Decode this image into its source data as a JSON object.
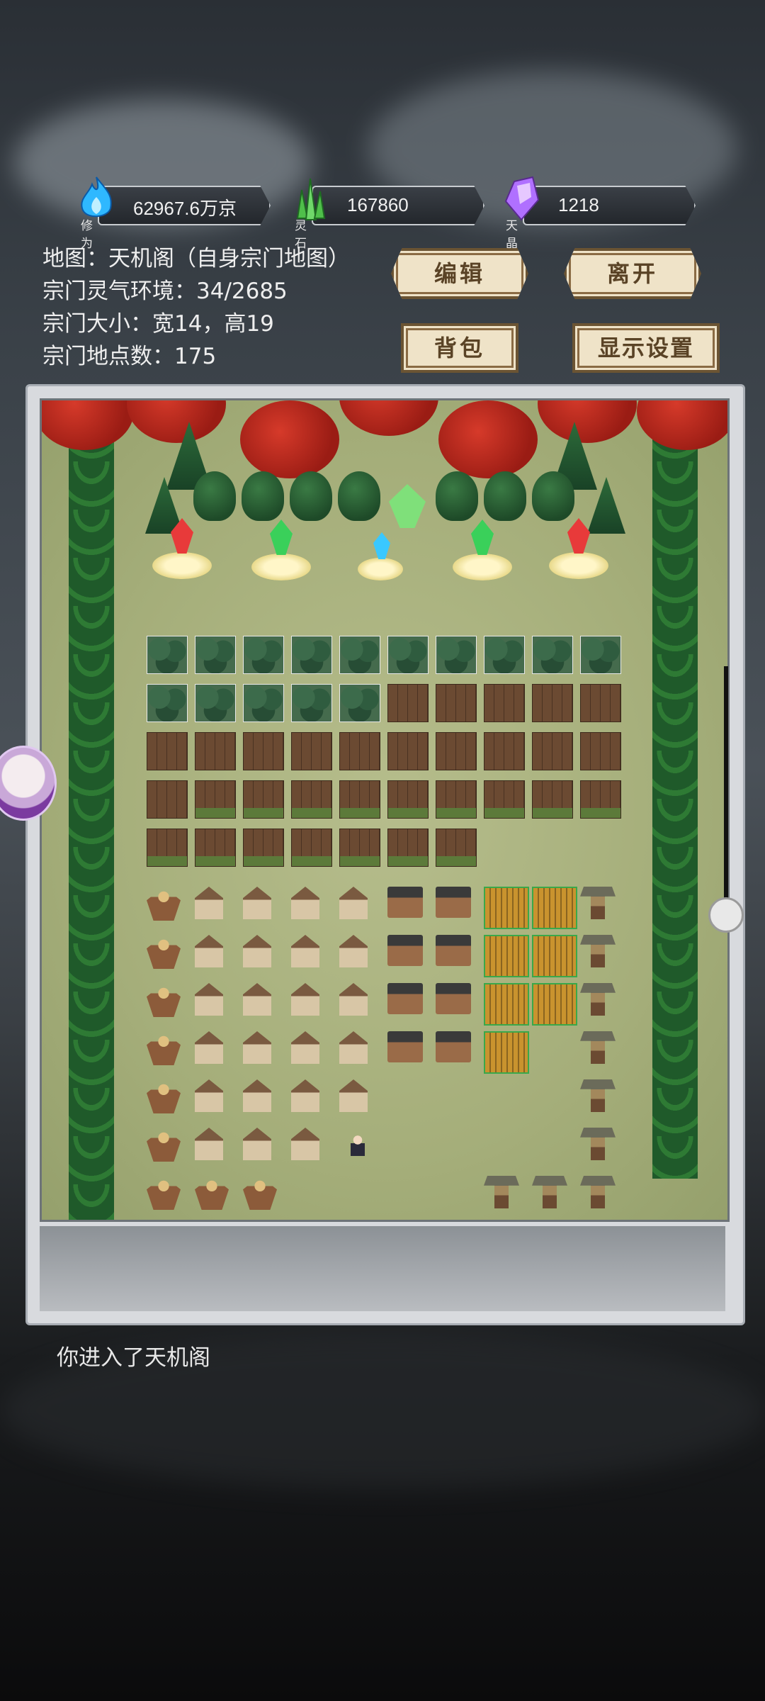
{
  "resources": [
    {
      "caption": "修为",
      "value": "62967.6万京",
      "icon": "blue-flame-icon",
      "color": "#2fb8ff"
    },
    {
      "caption": "灵石",
      "value": "167860",
      "icon": "green-crystal-icon",
      "color": "#5fd05a"
    },
    {
      "caption": "天晶",
      "value": "1218",
      "icon": "purple-crystal-icon",
      "color": "#b070ff"
    }
  ],
  "info": {
    "map": "地图：天机阁（自身宗门地图）",
    "aura": "宗门灵气环境：34/2685",
    "size": "宗门大小：宽14，高19",
    "places": "宗门地点数：175"
  },
  "buttons": {
    "edit": "编辑",
    "leave": "离开",
    "bag": "背包",
    "display": "显示设置"
  },
  "message": "你进入了天机阁"
}
